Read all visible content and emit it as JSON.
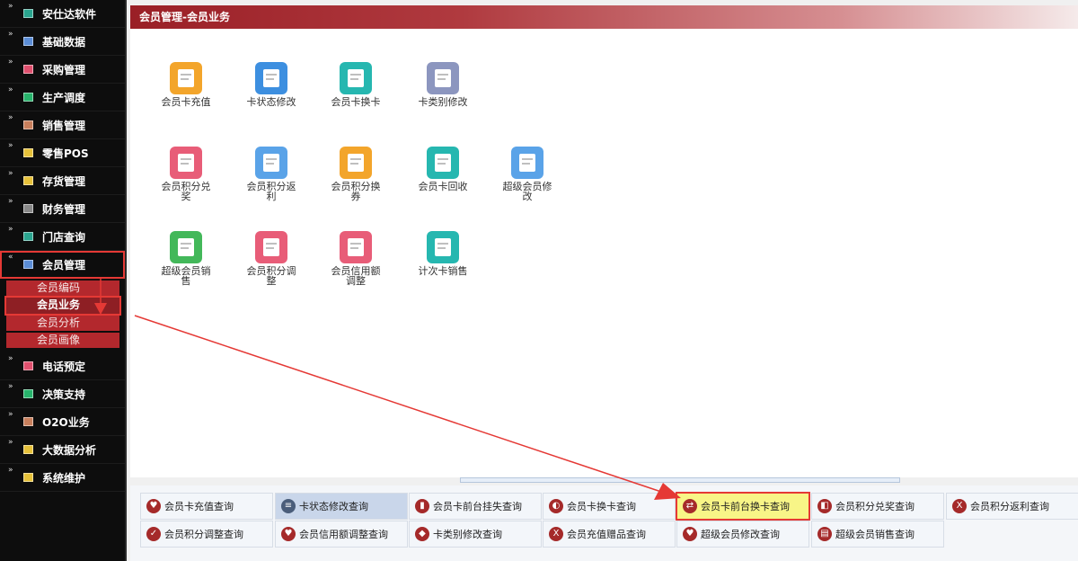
{
  "sidebar": {
    "items": [
      {
        "label": "安仕达软件",
        "color": "#2aa58f"
      },
      {
        "label": "基础数据",
        "color": "#5b8dd6"
      },
      {
        "label": "采购管理",
        "color": "#e0506e"
      },
      {
        "label": "生产调度",
        "color": "#27b36b"
      },
      {
        "label": "销售管理",
        "color": "#c87f5c"
      },
      {
        "label": "零售POS",
        "color": "#e6c13a"
      },
      {
        "label": "存货管理",
        "color": "#e6c13a"
      },
      {
        "label": "财务管理",
        "color": "#888888"
      },
      {
        "label": "门店查询",
        "color": "#2aa58f"
      },
      {
        "label": "会员管理",
        "color": "#5b8dd6"
      }
    ],
    "sub_items": [
      {
        "label": "会员编码"
      },
      {
        "label": "会员业务"
      },
      {
        "label": "会员分析"
      },
      {
        "label": "会员画像"
      }
    ],
    "items_after": [
      {
        "label": "电话预定",
        "color": "#e0506e"
      },
      {
        "label": "决策支持",
        "color": "#27b36b"
      },
      {
        "label": "O2O业务",
        "color": "#c87f5c"
      },
      {
        "label": "大数据分析",
        "color": "#e6c13a"
      },
      {
        "label": "系统维护",
        "color": "#e6c13a"
      }
    ]
  },
  "main": {
    "title": "会员管理-会员业务",
    "tiles": [
      {
        "label1": "会员卡充值",
        "label2": "",
        "color": "#f3a52b"
      },
      {
        "label1": "卡状态修改",
        "label2": "",
        "color": "#3d8fe0"
      },
      {
        "label1": "会员卡换卡",
        "label2": "",
        "color": "#26b7b0"
      },
      {
        "label1": "卡类别修改",
        "label2": "",
        "color": "#8c96bf"
      },
      {
        "label1": "会员积分兑",
        "label2": "奖",
        "color": "#e85d78"
      },
      {
        "label1": "会员积分返",
        "label2": "利",
        "color": "#5aa3e8"
      },
      {
        "label1": "会员积分换",
        "label2": "券",
        "color": "#f3a52b"
      },
      {
        "label1": "会员卡回收",
        "label2": "",
        "color": "#26b7b0"
      },
      {
        "label1": "超级会员修",
        "label2": "改",
        "color": "#5aa3e8"
      },
      {
        "label1": "超级会员销",
        "label2": "售",
        "color": "#43b85a"
      },
      {
        "label1": "会员积分调",
        "label2": "整",
        "color": "#e85d78"
      },
      {
        "label1": "会员信用额",
        "label2": "调整",
        "color": "#e85d78"
      },
      {
        "label1": "计次卡销售",
        "label2": "",
        "color": "#26b7b0"
      }
    ]
  },
  "queries": [
    {
      "label": "会员卡充值查询",
      "icon": "heart-icon"
    },
    {
      "label": "卡状态修改查询",
      "icon": "layers-icon"
    },
    {
      "label": "会员卡前台挂失查询",
      "icon": "bar-chart-icon"
    },
    {
      "label": "会员卡换卡查询",
      "icon": "swap-icon"
    },
    {
      "label": "会员卡前台换卡查询",
      "icon": "exchange-icon"
    },
    {
      "label": "会员积分兑奖查询",
      "icon": "gift-icon"
    },
    {
      "label": "会员积分返利查询",
      "icon": "x-icon"
    },
    {
      "label": "会员积分调整查询",
      "icon": "check-icon"
    },
    {
      "label": "会员信用额调整查询",
      "icon": "heart-icon"
    },
    {
      "label": "卡类别修改查询",
      "icon": "tag-icon"
    },
    {
      "label": "会员充值赠品查询",
      "icon": "x-icon"
    },
    {
      "label": "超级会员修改查询",
      "icon": "heart-icon"
    },
    {
      "label": "超级会员销售查询",
      "icon": "doc-icon"
    }
  ],
  "icons": {
    "arrow_color": "#e53935"
  }
}
